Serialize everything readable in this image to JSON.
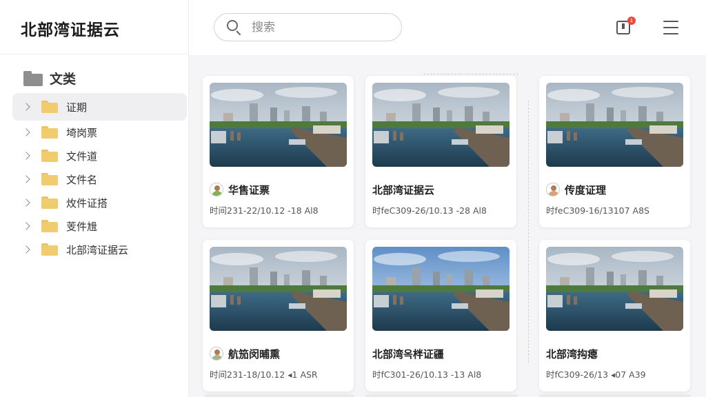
{
  "app": {
    "title": "北部湾证据云"
  },
  "search": {
    "placeholder": "搜索"
  },
  "notifications": {
    "badge": "1"
  },
  "sidebar": {
    "section_label": "文类",
    "items": [
      {
        "label": "证期"
      },
      {
        "label": "埼岗票"
      },
      {
        "label": "文件道"
      },
      {
        "label": "文件名"
      },
      {
        "label": "炇件证搭"
      },
      {
        "label": "芰件尳"
      },
      {
        "label": "北部湾证据云"
      }
    ]
  },
  "cards": [
    {
      "title": "华售证票",
      "meta": "时间231-22/10.12 -18 Al8",
      "has_avatar": true,
      "avatar_color": "#7fb356"
    },
    {
      "title": "北部湾证据云",
      "meta": "时feC309-26/10.13 -28 Al8",
      "has_avatar": false
    },
    {
      "title": "传度证理",
      "meta": "时feC309-16/13107 A8S",
      "has_avatar": true,
      "avatar_color": "#d9a27a"
    },
    {
      "title": "航笳闵晡熏",
      "meta": "时间231-18/10.12 ◂1 ASR",
      "has_avatar": true,
      "avatar_color": "#a7b48a"
    },
    {
      "title": "北部湾옥柈证疆",
      "meta": "时fC301-26/10.13 -13 Al8",
      "has_avatar": false
    },
    {
      "title": "北部湾抅瘪",
      "meta": "时fC309-26/13 ◂07 A39",
      "has_avatar": false
    }
  ],
  "colors": {
    "accent": "#f0cc6e",
    "badge": "#e74c3c",
    "active_bg": "#efeff1"
  }
}
